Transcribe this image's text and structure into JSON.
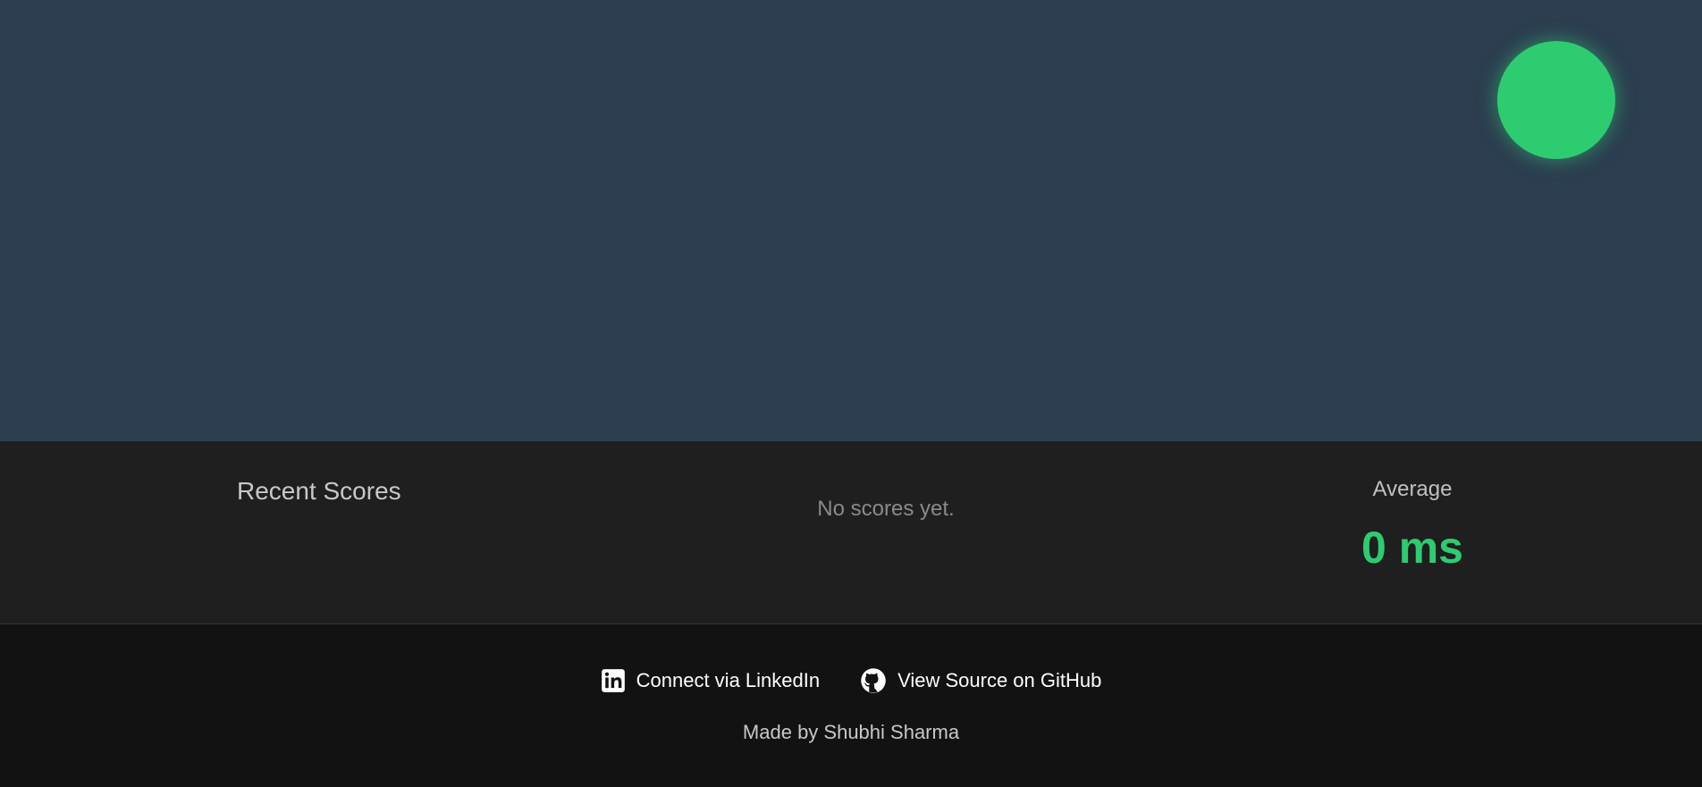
{
  "game": {
    "target_color": "#2ecc71",
    "background_color": "#2c3e50"
  },
  "scores": {
    "title": "Recent Scores",
    "empty_message": "No scores yet.",
    "average_label": "Average",
    "average_value": "0 ms"
  },
  "footer": {
    "linkedin_label": "Connect via LinkedIn",
    "linkedin_icon": "linkedin-icon",
    "github_label": "View Source on GitHub",
    "github_icon": "github-icon",
    "made_by": "Made by Shubhi Sharma"
  }
}
